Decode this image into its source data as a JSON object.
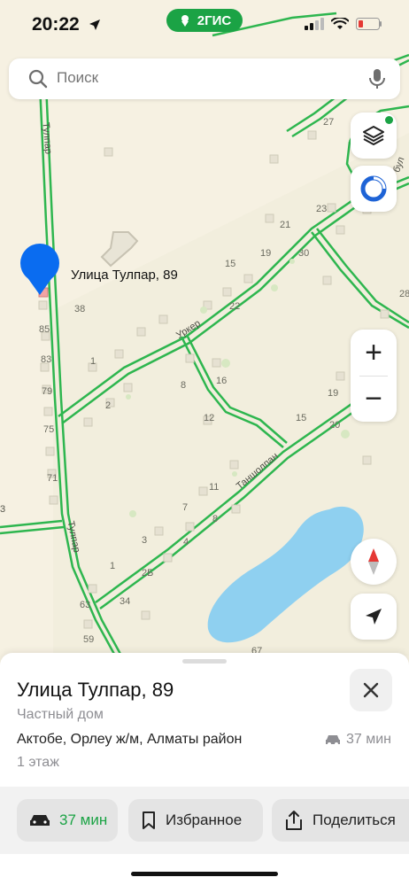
{
  "status_bar": {
    "time": "20:22",
    "brand": "2ГИС"
  },
  "search": {
    "placeholder": "Поиск"
  },
  "map": {
    "pin_label": "Улица Тулпар, 89",
    "street_labels": [
      "Тулпар",
      "Тулпар",
      "Уркер",
      "Таншолпан",
      "бул"
    ],
    "house_numbers": [
      "27",
      "23",
      "21",
      "15",
      "19",
      "30",
      "22",
      "28",
      "38",
      "85",
      "83",
      "79",
      "75",
      "71",
      "3",
      "1",
      "2",
      "8",
      "16",
      "12",
      "19",
      "15",
      "20",
      "11",
      "7",
      "8",
      "3",
      "4",
      "1",
      "2Б",
      "63",
      "34",
      "59",
      "67",
      "3"
    ]
  },
  "controls": {
    "zoom_in": "+",
    "zoom_out": "−"
  },
  "sheet": {
    "title": "Улица Тулпар, 89",
    "subtitle": "Частный дом",
    "address": "Актобе, Орлеу ж/м, Алматы район",
    "floor": "1 этаж",
    "eta": "37 мин"
  },
  "actions": {
    "route": "37 мин",
    "favorites": "Избранное",
    "share": "Поделиться"
  },
  "colors": {
    "brand_green": "#1ba345",
    "road_green": "#2eb64f",
    "map_bg": "#f5f0e1",
    "water": "#8fd0f0",
    "pin_blue": "#0a6cf0"
  }
}
